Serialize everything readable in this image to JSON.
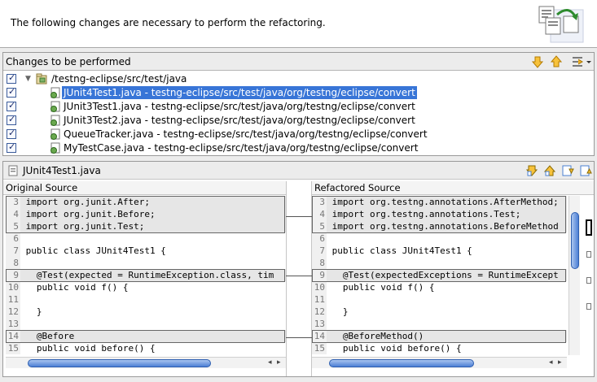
{
  "header": {
    "message": "The following changes are necessary to perform the refactoring."
  },
  "changes": {
    "title": "Changes to be performed",
    "root": "/testng-eclipse/src/test/java",
    "items": [
      {
        "label": "JUnit4Test1.java - testng-eclipse/src/test/java/org/testng/eclipse/convert",
        "selected": true
      },
      {
        "label": "JUnit3Test1.java - testng-eclipse/src/test/java/org/testng/eclipse/convert",
        "selected": false
      },
      {
        "label": "JUnit3Test2.java - testng-eclipse/src/test/java/org/testng/eclipse/convert",
        "selected": false
      },
      {
        "label": "QueueTracker.java - testng-eclipse/src/test/java/org/testng/eclipse/convert",
        "selected": false
      },
      {
        "label": "MyTestCase.java - testng-eclipse/src/test/java/org/testng/eclipse/convert",
        "selected": false
      }
    ]
  },
  "compare": {
    "title": "JUnit4Test1.java",
    "left_title": "Original Source",
    "right_title": "Refactored Source",
    "left_lines": [
      {
        "n": "3",
        "t": "import org.junit.After;"
      },
      {
        "n": "4",
        "t": "import org.junit.Before;"
      },
      {
        "n": "5",
        "t": "import org.junit.Test;"
      },
      {
        "n": "6",
        "t": ""
      },
      {
        "n": "7",
        "t": "public class JUnit4Test1 {"
      },
      {
        "n": "8",
        "t": ""
      },
      {
        "n": "9",
        "t": "  @Test(expected = RuntimeException.class, tim"
      },
      {
        "n": "10",
        "t": "  public void f() {"
      },
      {
        "n": "11",
        "t": ""
      },
      {
        "n": "12",
        "t": "  }"
      },
      {
        "n": "13",
        "t": ""
      },
      {
        "n": "14",
        "t": "  @Before"
      },
      {
        "n": "15",
        "t": "  public void before() {"
      }
    ],
    "right_lines": [
      {
        "n": "3",
        "t": "import org.testng.annotations.AfterMethod;"
      },
      {
        "n": "4",
        "t": "import org.testng.annotations.Test;"
      },
      {
        "n": "5",
        "t": "import org.testng.annotations.BeforeMethod"
      },
      {
        "n": "6",
        "t": ""
      },
      {
        "n": "7",
        "t": "public class JUnit4Test1 {"
      },
      {
        "n": "8",
        "t": ""
      },
      {
        "n": "9",
        "t": "  @Test(expectedExceptions = RuntimeExcept"
      },
      {
        "n": "10",
        "t": "  public void f() {"
      },
      {
        "n": "11",
        "t": ""
      },
      {
        "n": "12",
        "t": "  }"
      },
      {
        "n": "13",
        "t": ""
      },
      {
        "n": "14",
        "t": "  @BeforeMethod()"
      },
      {
        "n": "15",
        "t": "  public void before() {"
      }
    ]
  },
  "icons": {
    "next_change": "arrow-down-icon",
    "prev_change": "arrow-up-icon",
    "filter": "filter-menu-icon",
    "accent": "#3875d7"
  }
}
